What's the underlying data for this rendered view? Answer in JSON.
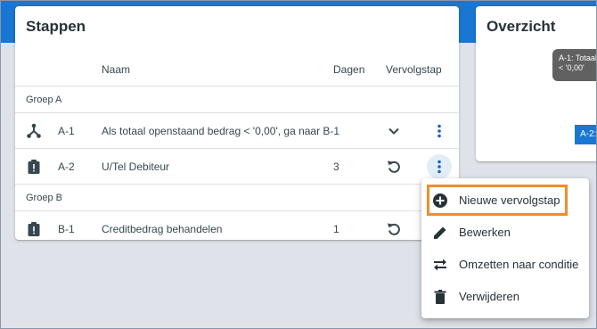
{
  "steps_panel": {
    "title": "Stappen",
    "columns": {
      "name": "Naam",
      "days": "Dagen",
      "next": "Vervolgstap"
    },
    "groups": [
      {
        "label": "Groep A",
        "rows": [
          {
            "code": "A-1",
            "name": "Als totaal openstaand bedrag < '0,00', ga naar B-1",
            "days": "",
            "type_icon": "branch-icon",
            "next_icon": "chevron-down-icon"
          },
          {
            "code": "A-2",
            "name": "U/Tel Debiteur",
            "days": "3",
            "type_icon": "clipboard-alert-icon",
            "next_icon": "restore-icon"
          }
        ]
      },
      {
        "label": "Groep B",
        "rows": [
          {
            "code": "B-1",
            "name": "Creditbedrag behandelen",
            "days": "1",
            "type_icon": "clipboard-alert-icon",
            "next_icon": "restore-icon"
          }
        ]
      }
    ]
  },
  "overview_panel": {
    "title": "Overzicht",
    "node_a1_line1": "A-1: Totaal",
    "node_a1_line2": "< '0,00'",
    "node_a2": "A-2:"
  },
  "context_menu": {
    "items": [
      {
        "label": "Nieuwe vervolgstap",
        "icon": "plus-circle-icon"
      },
      {
        "label": "Bewerken",
        "icon": "pencil-icon"
      },
      {
        "label": "Omzetten naar conditie",
        "icon": "swap-arrows-icon"
      },
      {
        "label": "Verwijderen",
        "icon": "trash-icon"
      }
    ]
  },
  "colors": {
    "header_blue": "#1976d2",
    "highlight_orange": "#f28c28",
    "icon_dark": "#37474f",
    "menu_dots_blue": "#1565c0"
  }
}
